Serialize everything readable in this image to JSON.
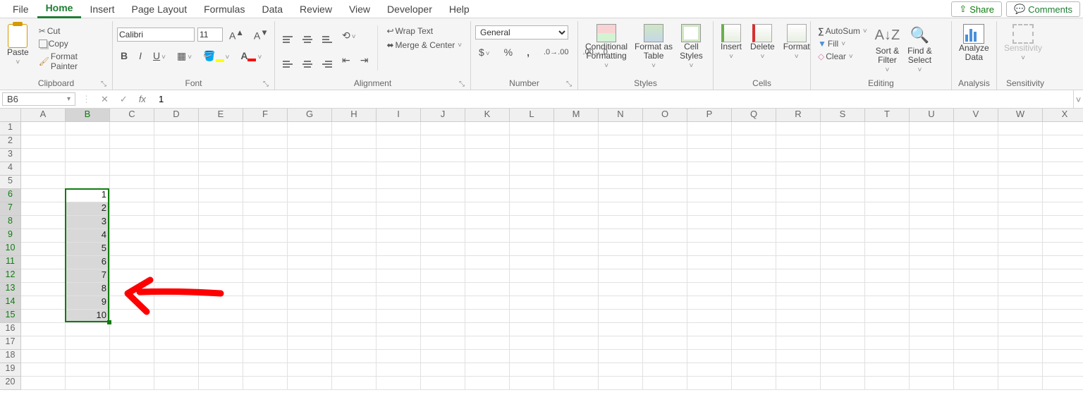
{
  "tabs": [
    "File",
    "Home",
    "Insert",
    "Page Layout",
    "Formulas",
    "Data",
    "Review",
    "View",
    "Developer",
    "Help"
  ],
  "active_tab": "Home",
  "share": "Share",
  "comments": "Comments",
  "clipboard": {
    "paste": "Paste",
    "cut": "Cut",
    "copy": "Copy",
    "format_painter": "Format Painter",
    "label": "Clipboard"
  },
  "font": {
    "name": "Calibri",
    "size": "11",
    "label": "Font"
  },
  "alignment": {
    "wrap": "Wrap Text",
    "merge": "Merge & Center",
    "label": "Alignment"
  },
  "number": {
    "format": "General",
    "label": "Number"
  },
  "styles": {
    "conditional": "Conditional\nFormatting",
    "format_as": "Format as\nTable",
    "cell_styles": "Cell\nStyles",
    "label": "Styles"
  },
  "cells": {
    "insert": "Insert",
    "delete": "Delete",
    "format": "Format",
    "label": "Cells"
  },
  "editing": {
    "autosum": "AutoSum",
    "fill": "Fill",
    "clear": "Clear",
    "sort": "Sort &\nFilter",
    "find": "Find &\nSelect",
    "label": "Editing"
  },
  "analysis": {
    "analyze": "Analyze\nData",
    "label": "Analysis"
  },
  "sensitivity": {
    "btn": "Sensitivity",
    "label": "Sensitivity"
  },
  "namebox": "B6",
  "formula_value": "1",
  "columns": [
    "A",
    "B",
    "C",
    "D",
    "E",
    "F",
    "G",
    "H",
    "I",
    "J",
    "K",
    "L",
    "M",
    "N",
    "O",
    "P",
    "Q",
    "R",
    "S",
    "T",
    "U",
    "V",
    "W",
    "X"
  ],
  "rows": 20,
  "selected_col": "B",
  "selected_rows": [
    6,
    7,
    8,
    9,
    10,
    11,
    12,
    13,
    14,
    15
  ],
  "active_cell": "B6",
  "cell_values": {
    "B6": "1",
    "B7": "2",
    "B8": "3",
    "B9": "4",
    "B10": "5",
    "B11": "6",
    "B12": "7",
    "B13": "8",
    "B14": "9",
    "B15": "10"
  }
}
